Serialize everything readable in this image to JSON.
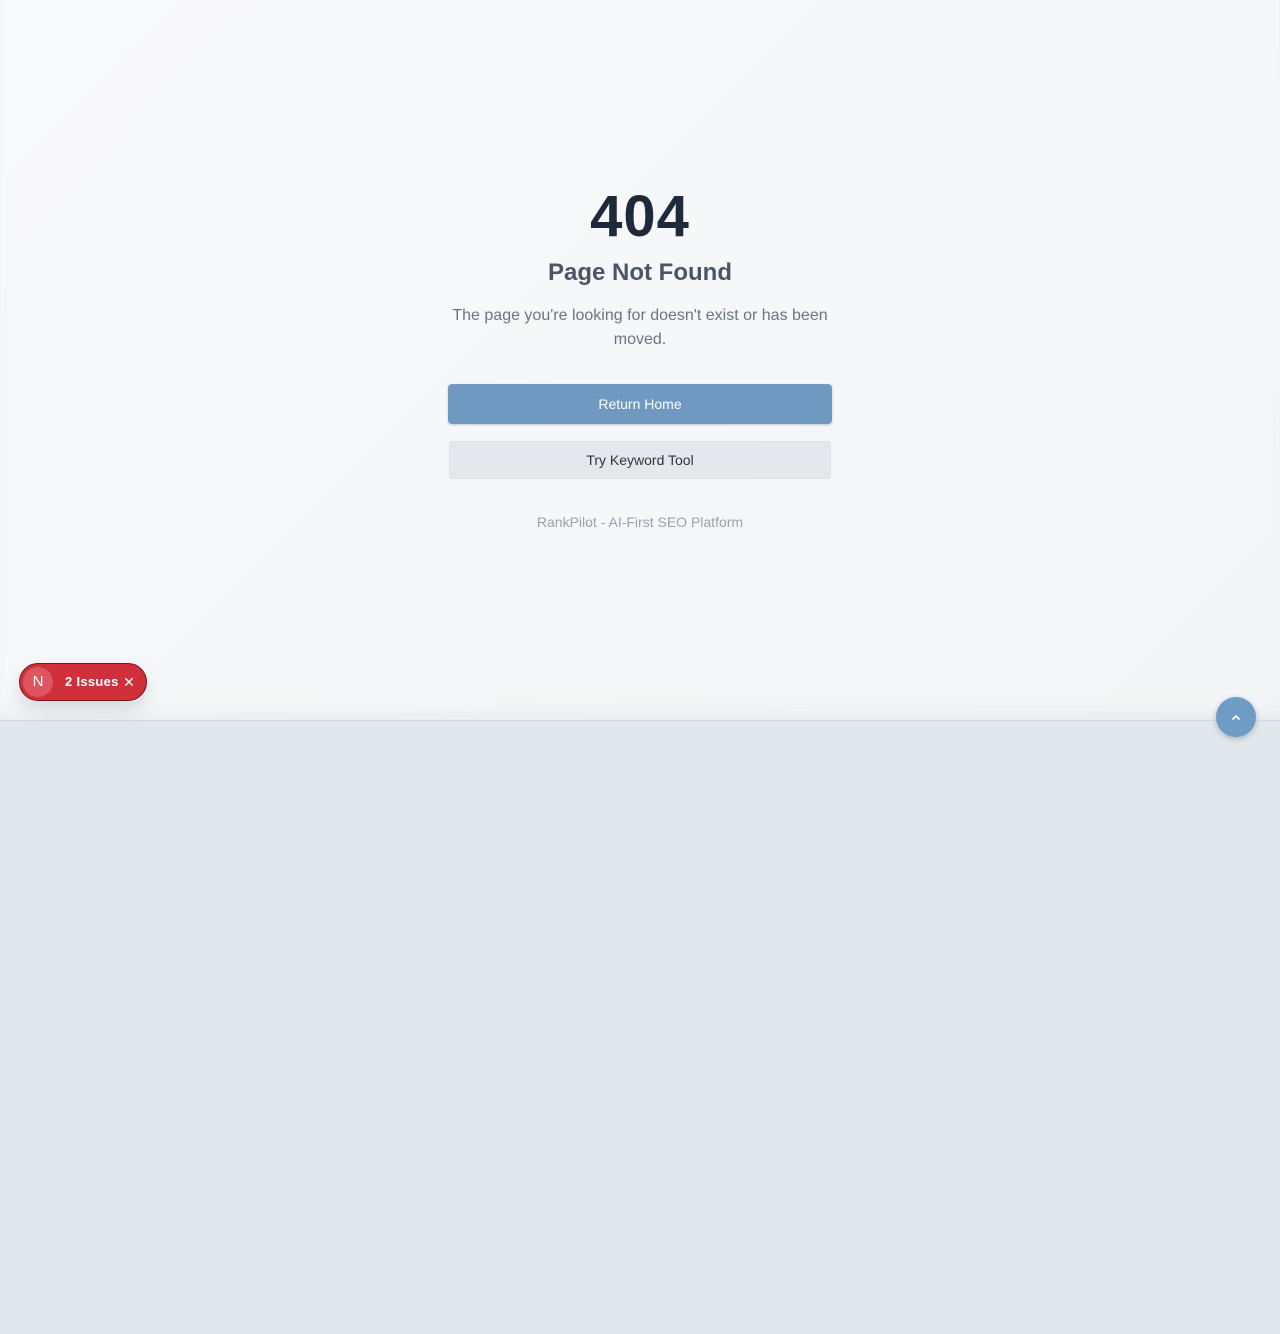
{
  "error": {
    "code": "404",
    "title": "Page Not Found",
    "description": "The page you're looking for doesn't exist or has been moved."
  },
  "actions": {
    "primary_label": "Return Home",
    "secondary_label": "Try Keyword Tool"
  },
  "footer": {
    "brand_text": "RankPilot - AI-First SEO Platform"
  },
  "dev_indicator": {
    "badge_letter": "N",
    "issues_label": "2 Issues",
    "close_icon": "close-icon",
    "color": "#d0303b"
  },
  "scroll_top": {
    "icon": "chevron-up-icon",
    "color": "#6f9bc7"
  },
  "colors": {
    "primary_button": "#7099c1",
    "heading": "#1e2a3a",
    "page_background": "#f5f7f9"
  }
}
